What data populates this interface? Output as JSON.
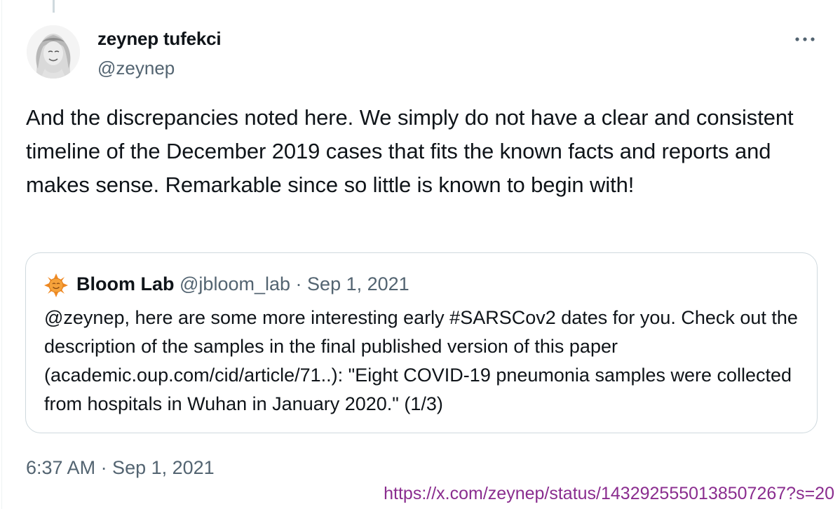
{
  "tweet": {
    "author_name": "zeynep tufekci",
    "author_handle": "@zeynep",
    "text": "And the discrepancies noted here. We simply do not have a clear and consistent timeline of the December 2019 cases that fits the known facts and reports and makes sense. Remarkable since so little is known to begin with!",
    "timestamp": "6:37 AM · Sep 1, 2021",
    "more_icon": "more-horizontal-icon"
  },
  "quoted_tweet": {
    "author_name": "Bloom Lab",
    "author_handle": "@jbloom_lab",
    "separator": "·",
    "date": "Sep 1, 2021",
    "text": "@zeynep, here are some more interesting early #SARSCov2 dates for you. Check out the description of the samples in the final published version of this paper (academic.oup.com/cid/article/71..): \"Eight COVID-19 pneumonia samples were collected from hospitals in Wuhan in January 2020.\" (1/3)",
    "avatar_icon": "sun-logo-icon"
  },
  "source_url": "https://x.com/zeynep/status/1432925550138507267?s=20",
  "colors": {
    "text_primary": "#0f1419",
    "text_secondary": "#536471",
    "border": "#cfd9de",
    "url_purple": "#8a2d8f",
    "sun_orange": "#f08a24"
  }
}
